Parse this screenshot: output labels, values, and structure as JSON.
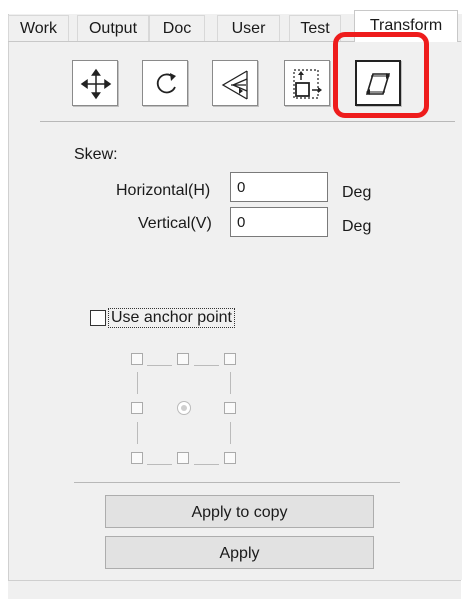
{
  "tabs": [
    {
      "label": "Work"
    },
    {
      "label": "Output"
    },
    {
      "label": "Doc"
    },
    {
      "label": "User"
    },
    {
      "label": "Test"
    },
    {
      "label": "Transform",
      "active": true
    }
  ],
  "toolbar": [
    {
      "icon": "move-icon"
    },
    {
      "icon": "rotate-icon"
    },
    {
      "icon": "mirror-icon"
    },
    {
      "icon": "resize-icon"
    },
    {
      "icon": "skew-icon",
      "selected": true
    }
  ],
  "skew": {
    "section_label": "Skew:",
    "horizontal": {
      "label": "Horizontal(H)",
      "value": "0",
      "unit": "Deg"
    },
    "vertical": {
      "label": "Vertical(V)",
      "value": "0",
      "unit": "Deg"
    }
  },
  "anchor": {
    "checkbox_label": "Use anchor point",
    "checked": false
  },
  "buttons": {
    "apply_to_copy": "Apply to copy",
    "apply": "Apply"
  },
  "colors": {
    "highlight": "#ee1c1c",
    "panel_bg": "#f0f0f0"
  }
}
